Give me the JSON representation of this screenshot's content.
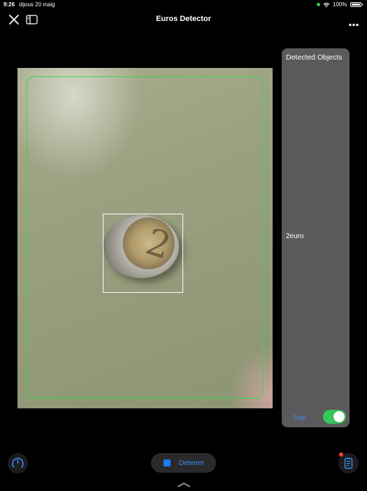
{
  "status_bar": {
    "time": "9:26",
    "date": "dijous 20 maig",
    "battery": "100%"
  },
  "nav": {
    "title": "Euros Detector",
    "close_icon": "close-icon",
    "sidebar_icon": "sidebar-icon",
    "more_icon": "more-icon"
  },
  "camera": {
    "frame_color": "#35d94a",
    "detection_box_color": "#ffffff"
  },
  "panel": {
    "title": "Detected Objects",
    "detected": [
      "2euro"
    ],
    "stop_label": "Stop",
    "toggle_on": true
  },
  "bottom": {
    "detener_label": "Detener",
    "gauge_icon": "gauge-icon",
    "document_icon": "document-icon",
    "accent": "#1c7cf5"
  }
}
